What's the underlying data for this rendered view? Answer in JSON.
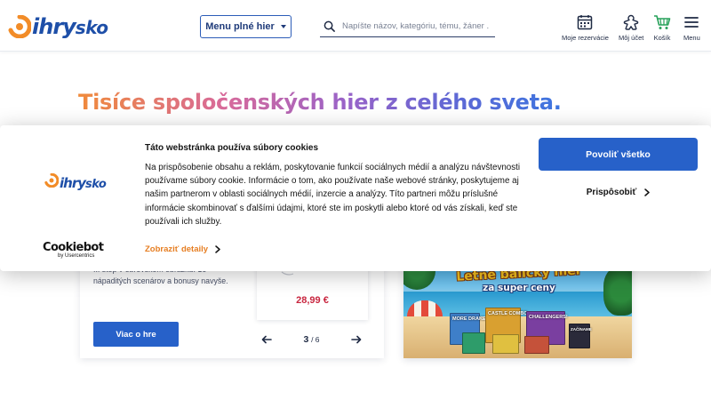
{
  "header": {
    "logo_text_main": "ihry",
    "logo_text_sub": "sko",
    "menu_button_label": "Menu plné hier",
    "search_placeholder": "Napíšte názov, kategóriu, tému, žáner ...",
    "icons": [
      {
        "name": "calendar-icon",
        "label": "Moje rezervácie"
      },
      {
        "name": "meeple-icon",
        "label": "Môj účet"
      },
      {
        "name": "cart-icon",
        "label": "Košík"
      },
      {
        "name": "hamburger-icon",
        "label": "Menu"
      }
    ]
  },
  "hero": {
    "title": "Tisíce spoločenských hier z celého sveta."
  },
  "card": {
    "description": "... stôp v obrovskom obrázku. 16 nápaditých scenárov a bonusy navyše.",
    "more_button": "Viac o hre",
    "product_price": "28,99 €",
    "pager_current": "3",
    "pager_total": "/ 6"
  },
  "promo": {
    "headline": "Letné balíčky hier",
    "subheadline": "za super ceny",
    "boxes": [
      "MORE DRAKE",
      "CASTLE COMBO",
      "CHALLENGERS!",
      "ZAČÍNAME"
    ]
  },
  "cookie_banner": {
    "logo_text_main": "ihry",
    "logo_text_sub": "sko",
    "title": "Táto webstránka používa súbory cookies",
    "body": "Na prispôsobenie obsahu a reklám, poskytovanie funkcií sociálnych médií a analýzu návštevnosti používame súbory cookie. Informácie o tom, ako používate naše webové stránky, poskytujeme aj našim partnerom v oblasti sociálnych médií, inzercie a analýzy. Títo partneri môžu príslušné informácie skombinovať s ďalšími údajmi, ktoré ste im poskytli alebo ktoré od vás získali, keď ste používali ich služby.",
    "details_link": "Zobraziť detaily",
    "allow_all_button": "Povoliť všetko",
    "customize_button": "Prispôsobiť",
    "cookiebot_name": "Cookiebot",
    "cookiebot_by": "by Usercentrics"
  },
  "colors": {
    "brand_blue": "#2761c9",
    "logo_orange": "#f28c28",
    "price_red": "#c8263f",
    "details_orange": "#e67e22"
  }
}
